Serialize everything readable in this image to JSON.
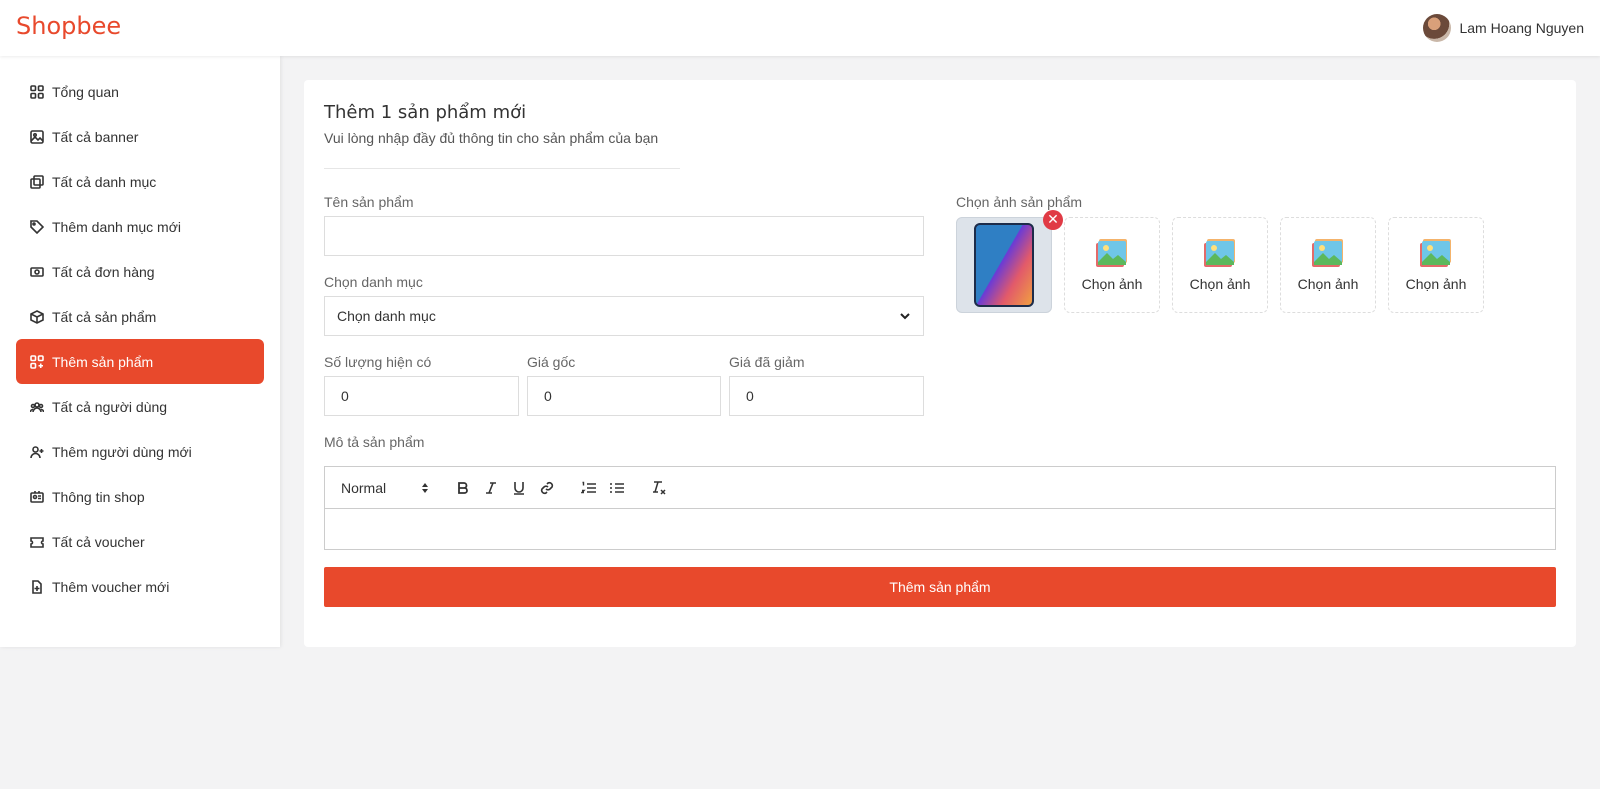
{
  "header": {
    "brand": "Shopbee",
    "user_name": "Lam Hoang Nguyen"
  },
  "sidebar": {
    "items": [
      {
        "label": "Tổng quan",
        "icon": "grid-icon"
      },
      {
        "label": "Tất cả banner",
        "icon": "image-icon"
      },
      {
        "label": "Tất cả danh mục",
        "icon": "copy-icon"
      },
      {
        "label": "Thêm danh mục mới",
        "icon": "tag-icon"
      },
      {
        "label": "Tất cả đơn hàng",
        "icon": "money-icon"
      },
      {
        "label": "Tất cả sản phẩm",
        "icon": "box-icon"
      },
      {
        "label": "Thêm sản phẩm",
        "icon": "grid-plus-icon",
        "active": true
      },
      {
        "label": "Tất cả người dùng",
        "icon": "users-icon"
      },
      {
        "label": "Thêm người dùng mới",
        "icon": "user-plus-icon"
      },
      {
        "label": "Thông tin shop",
        "icon": "id-card-icon"
      },
      {
        "label": "Tất cả voucher",
        "icon": "ticket-icon"
      },
      {
        "label": "Thêm voucher mới",
        "icon": "file-plus-icon"
      }
    ],
    "active_color": "#e8492c"
  },
  "form": {
    "title": "Thêm 1 sản phẩm mới",
    "subtitle": "Vui lòng nhập đầy đủ thông tin cho sản phẩm của bạn",
    "name_label": "Tên sản phẩm",
    "name_value": "",
    "category_label": "Chọn danh mục",
    "category_selected": "Chọn danh mục",
    "quantity_label": "Số lượng hiện có",
    "quantity_value": "0",
    "price_label": "Giá gốc",
    "price_value": "0",
    "discount_label": "Giá đã giảm",
    "discount_value": "0",
    "description_label": "Mô tả sản phẩm",
    "editor_format": "Normal",
    "images_label": "Chọn ảnh sản phẩm",
    "image_slot_label": "Chọn ảnh",
    "submit_label": "Thêm sản phẩm"
  },
  "colors": {
    "accent": "#e8492c",
    "remove": "#e03a45"
  }
}
